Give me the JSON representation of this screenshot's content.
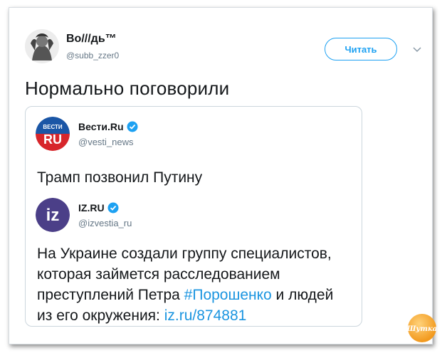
{
  "author": {
    "name": "Во///дь™",
    "handle": "@subb_zzer0"
  },
  "follow_button": "Читать",
  "tweet_text": "Нормально поговорили",
  "quoted_1": {
    "name": "Вести.Ru",
    "handle": "@vesti_news",
    "logo_top": "ВЕСТИ",
    "logo_bottom": "RU",
    "text": "Трамп позвонил Путину"
  },
  "quoted_2": {
    "name": "IZ.RU",
    "handle": "@izvestia_ru",
    "logo_text": "iz",
    "line1": "На Украине создали группу специалистов,",
    "line2": "которая займется расследованием",
    "line3_prefix": "преступлений Петра ",
    "hashtag": "#Порошенко",
    "line3_suffix": " и людей",
    "line4_prefix": "из его окружения: ",
    "link": "iz.ru/874881"
  },
  "watermark_text": "Шутка",
  "colors": {
    "accent": "#1da1f2",
    "link": "#1b95e0",
    "vesti_blue": "#1b56a6",
    "vesti_red": "#d7262b",
    "iz_purple": "#4b3f88"
  }
}
